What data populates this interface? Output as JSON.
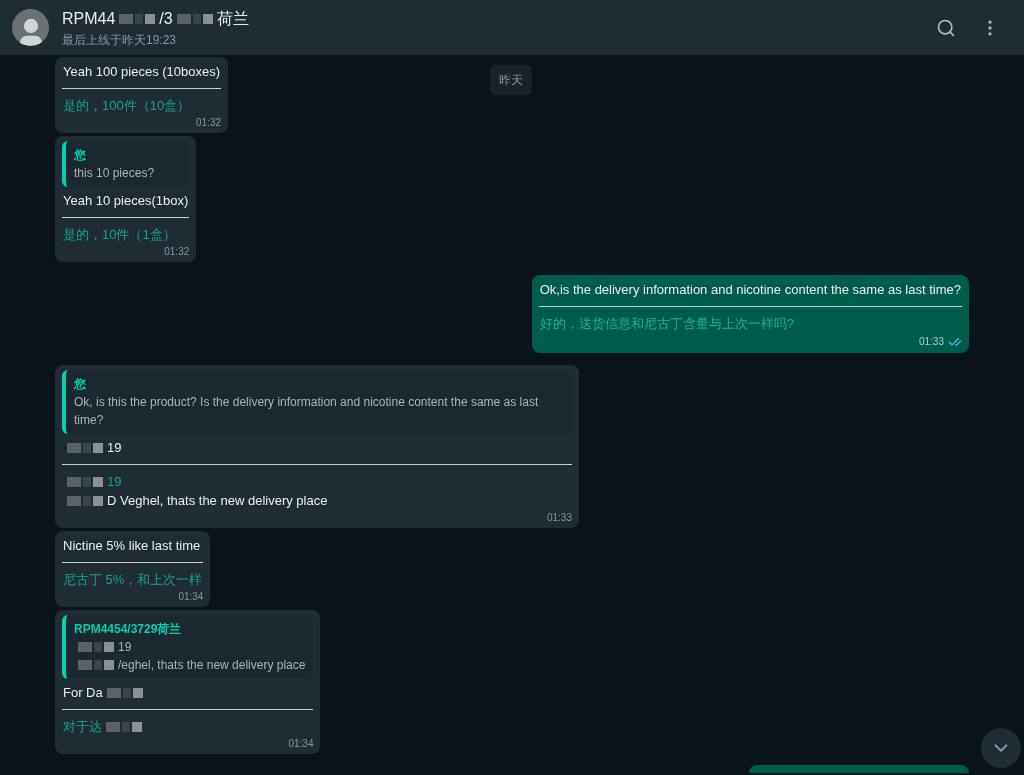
{
  "header": {
    "title_parts": [
      "RPM44",
      "/3",
      "荷兰"
    ],
    "status": "最后上线于昨天19:23"
  },
  "date_chip": "昨天",
  "messages": [
    {
      "kind": "incoming",
      "lines": [
        {
          "kind": "original",
          "text": "Yeah 100 pieces (10boxes)"
        },
        {
          "kind": "divider"
        },
        {
          "kind": "translation",
          "text": "是的，100件（10盒）"
        }
      ],
      "time": "01:32"
    },
    {
      "kind": "incoming",
      "quote": {
        "author": "您",
        "lines": [
          "this 10 pieces?"
        ]
      },
      "lines": [
        {
          "kind": "original",
          "text": "Yeah 10 pieces(1box)"
        },
        {
          "kind": "divider"
        },
        {
          "kind": "translation",
          "text": "是的，10件（1盒）"
        }
      ],
      "time": "01:32"
    },
    {
      "kind": "outgoing",
      "read": true,
      "lines": [
        {
          "kind": "original",
          "text": "Ok,is the delivery information and nicotine content the same as last time?"
        },
        {
          "kind": "divider"
        },
        {
          "kind": "translation",
          "text": "好的，送货信息和尼古丁含量与上次一样吗?"
        }
      ],
      "time": "01:33"
    },
    {
      "kind": "incoming",
      "quote": {
        "author": "您",
        "lines": [
          "Ok, is this the product? Is the delivery information and nicotine content the same as last time?"
        ]
      },
      "lines": [
        {
          "kind": "original",
          "text": [
            {
              "kind": "redacted"
            },
            {
              "kind": "text",
              "text": "19"
            }
          ]
        },
        {
          "kind": "divider"
        },
        {
          "kind": "translation",
          "text": [
            {
              "kind": "redacted"
            },
            {
              "kind": "text",
              "text": "19"
            }
          ]
        },
        {
          "kind": "original",
          "text": [
            {
              "kind": "redacted"
            },
            {
              "kind": "text",
              "text": "D Veghel, thats the new delivery place"
            }
          ]
        }
      ],
      "time": "01:33"
    },
    {
      "kind": "incoming",
      "lines": [
        {
          "kind": "original",
          "text": "Nictine 5% like last time"
        },
        {
          "kind": "divider"
        },
        {
          "kind": "translation",
          "text": "尼古丁 5%，和上次一样"
        }
      ],
      "time": "01:34"
    },
    {
      "kind": "incoming",
      "quote": {
        "author": "RPM4454/3729荷兰",
        "lines": [
          [
            {
              "kind": "redacted"
            },
            {
              "kind": "text",
              "text": "19"
            }
          ],
          [
            {
              "kind": "redacted"
            },
            {
              "kind": "text",
              "text": "/eghel, thats the new delivery place"
            }
          ]
        ]
      },
      "lines": [
        {
          "kind": "original",
          "text": [
            {
              "kind": "text",
              "text": "For Da"
            },
            {
              "kind": "redacted"
            }
          ]
        },
        {
          "kind": "divider"
        },
        {
          "kind": "translation",
          "text": [
            {
              "kind": "text",
              "text": "对于达"
            },
            {
              "kind": "redacted"
            }
          ]
        }
      ],
      "time": "01:34"
    },
    {
      "kind": "outgoing"
    }
  ]
}
